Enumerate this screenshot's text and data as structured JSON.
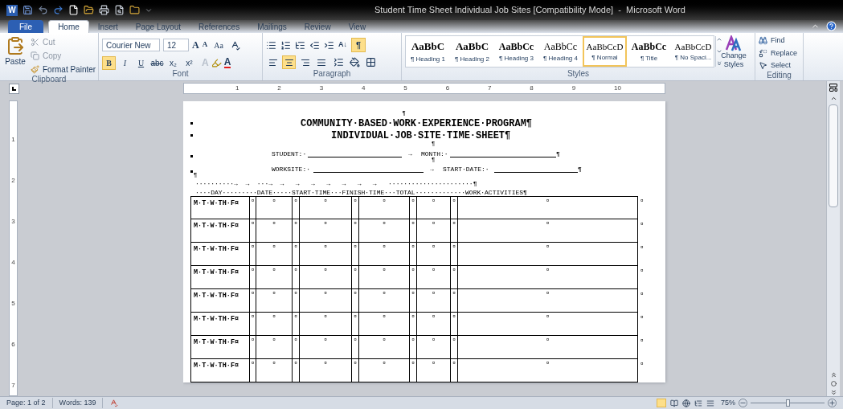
{
  "window": {
    "title": "Student Time Sheet Individual Job Sites [Compatibility Mode]  -  Microsoft Word",
    "logo": "W"
  },
  "tabs": [
    {
      "label": "File",
      "kind": "file",
      "selected": false
    },
    {
      "label": "Home",
      "kind": "tab",
      "selected": true
    },
    {
      "label": "Insert",
      "kind": "tab",
      "selected": false
    },
    {
      "label": "Page Layout",
      "kind": "tab",
      "selected": false
    },
    {
      "label": "References",
      "kind": "tab",
      "selected": false
    },
    {
      "label": "Mailings",
      "kind": "tab",
      "selected": false
    },
    {
      "label": "Review",
      "kind": "tab",
      "selected": false
    },
    {
      "label": "View",
      "kind": "tab",
      "selected": false
    }
  ],
  "clipboard": {
    "paste": "Paste",
    "cut": "Cut",
    "copy": "Copy",
    "format_painter": "Format Painter",
    "group": "Clipboard"
  },
  "font": {
    "name": "Courier New",
    "size": "12",
    "grow": "A",
    "shrink": "A",
    "change_case": "Aa",
    "effects": "A",
    "font_color_label": "A",
    "group": "Font",
    "toggles": [
      {
        "label": "B",
        "kind": "bold",
        "selected": true
      },
      {
        "label": "I",
        "kind": "italic",
        "selected": false
      },
      {
        "label": "U",
        "kind": "underline",
        "selected": false
      },
      {
        "label": "abc",
        "kind": "strike",
        "selected": false
      },
      {
        "label": "x₂",
        "kind": "sub",
        "selected": false
      },
      {
        "label": "x²",
        "kind": "sup",
        "selected": false
      }
    ]
  },
  "paragraph": {
    "group": "Paragraph",
    "sort": "A↓",
    "show_marks": {
      "label": "¶",
      "selected": true
    },
    "align": [
      {
        "kind": "left",
        "selected": false
      },
      {
        "kind": "center",
        "selected": true
      },
      {
        "kind": "right",
        "selected": false
      },
      {
        "kind": "justify",
        "selected": false
      }
    ]
  },
  "styles": {
    "group": "Styles",
    "change": "Change Styles",
    "items": [
      {
        "preview": "AaBbC",
        "label": "¶ Heading 1",
        "kind": "h1",
        "selected": false
      },
      {
        "preview": "AaBbC",
        "label": "¶ Heading 2",
        "kind": "h2",
        "selected": false
      },
      {
        "preview": "AaBbCc",
        "label": "¶ Heading 3",
        "kind": "h3",
        "selected": false
      },
      {
        "preview": "AaBbCc",
        "label": "¶ Heading 4",
        "kind": "h4",
        "selected": false
      },
      {
        "preview": "AaBbCcD",
        "label": "¶ Normal",
        "kind": "normal",
        "selected": true
      },
      {
        "preview": "AaBbCc",
        "label": "¶ Title",
        "kind": "title",
        "selected": false
      },
      {
        "preview": "AaBbCcD",
        "label": "¶ No Spaci...",
        "kind": "normal",
        "selected": false
      }
    ]
  },
  "editing": {
    "group": "Editing",
    "find": "Find",
    "replace": "Replace",
    "select": "Select"
  },
  "ruler": {
    "numbers": [
      "1",
      "2",
      "3",
      "4",
      "5",
      "6",
      "7",
      "8",
      "9",
      "10"
    ],
    "vertical_numbers": [
      "1",
      "2",
      "3",
      "4",
      "5",
      "6",
      "7"
    ]
  },
  "document": {
    "top_mark": "¶",
    "title_lines": [
      "COMMUNITY·BASED·WORK·EXPERIENCE·PROGRAM¶",
      "INDIVIDUAL·JOB·SITE·TIME·SHEET¶"
    ],
    "mid_mark": "¶",
    "fields": [
      {
        "left_label": "STUDENT:·",
        "tab": "→",
        "right_label": "MONTH:·",
        "end": "¶",
        "after": "¶"
      },
      {
        "left_label": "WORKSITE:·",
        "tab": "→",
        "right_label": "START·DATE:·",
        "end": "¶",
        "after": "¶"
      }
    ],
    "tab_line": "··········→  →  ···→  →   →   →   →   →   →   →   ······················¶",
    "header_line": "····DAY·········DATE·····START·TIME···FINISH·TIME···TOTAL·············WORK·ACTIVITIES¶",
    "rows": [
      {
        "day": "M·T·W·TH·F¤",
        "cells": [
          "¤",
          "¤",
          "¤",
          "¤",
          "¤",
          "¤",
          "¤",
          "¤",
          "¤",
          "¤"
        ],
        "end": "¤"
      },
      {
        "day": "M·T·W·TH·F¤",
        "cells": [
          "¤",
          "¤",
          "¤",
          "¤",
          "¤",
          "¤",
          "¤",
          "¤",
          "¤",
          "¤"
        ],
        "end": "¤"
      },
      {
        "day": "M·T·W·TH·F¤",
        "cells": [
          "¤",
          "¤",
          "¤",
          "¤",
          "¤",
          "¤",
          "¤",
          "¤",
          "¤",
          "¤"
        ],
        "end": "¤"
      },
      {
        "day": "M·T·W·TH·F¤",
        "cells": [
          "¤",
          "¤",
          "¤",
          "¤",
          "¤",
          "¤",
          "¤",
          "¤",
          "¤",
          "¤"
        ],
        "end": "¤"
      },
      {
        "day": "M·T·W·TH·F¤",
        "cells": [
          "¤",
          "¤",
          "¤",
          "¤",
          "¤",
          "¤",
          "¤",
          "¤",
          "¤",
          "¤"
        ],
        "end": "¤"
      },
      {
        "day": "M·T·W·TH·F¤",
        "cells": [
          "¤",
          "¤",
          "¤",
          "¤",
          "¤",
          "¤",
          "¤",
          "¤",
          "¤",
          "¤"
        ],
        "end": "¤"
      },
      {
        "day": "M·T·W·TH·F¤",
        "cells": [
          "¤",
          "¤",
          "¤",
          "¤",
          "¤",
          "¤",
          "¤",
          "¤",
          "¤",
          "¤"
        ],
        "end": "¤"
      },
      {
        "day": "M·T·W·TH·F¤",
        "cells": [
          "¤",
          "¤",
          "¤",
          "¤",
          "¤",
          "¤",
          "¤",
          "¤",
          "¤",
          "¤"
        ],
        "end": "¤"
      }
    ]
  },
  "status_bar": {
    "page": "Page: 1 of 2",
    "words": "Words: 139",
    "zoom": {
      "label": "75%",
      "level": 0.5
    }
  }
}
